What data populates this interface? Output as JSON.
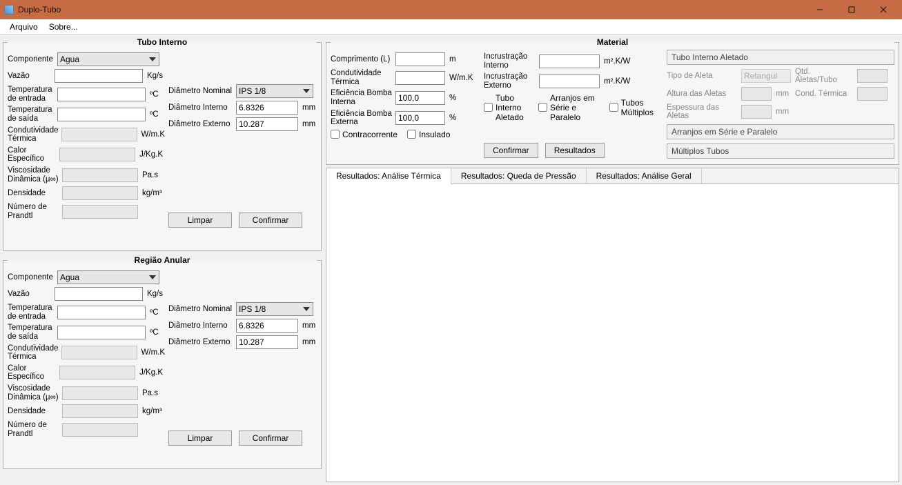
{
  "window": {
    "title": "Duplo-Tubo"
  },
  "menu": {
    "arquivo": "Arquivo",
    "sobre": "Sobre..."
  },
  "tubo_interno": {
    "legend": "Tubo Interno",
    "componente_label": "Componente",
    "componente_value": "Agua",
    "vazao_label": "Vazão",
    "vazao_unit": "Kg/s",
    "temp_entrada_label": "Temperatura de entrada",
    "temp_entrada_unit": "ºC",
    "temp_saida_label": "Temperatura de saída",
    "temp_saida_unit": "ºC",
    "diam_nom_label": "Diâmetro Nominal",
    "diam_nom_value": "IPS 1/8",
    "diam_int_label": "Diâmetro Interno",
    "diam_int_value": "6.8326",
    "diam_int_unit": "mm",
    "diam_ext_label": "Diâmetro Externo",
    "diam_ext_value": "10.287",
    "diam_ext_unit": "mm",
    "cond_term_label": "Condutividade Térmica",
    "cond_term_unit": "W/m.K",
    "calor_esp_label": "Calor Específico",
    "calor_esp_unit": "J/Kg.K",
    "visc_din_label": "Viscosidade Dinâmica (µ∞)",
    "visc_din_unit": "Pa.s",
    "dens_label": "Densidade",
    "dens_unit": "kg/m³",
    "prandtl_label": "Número de Prandtl",
    "btn_limpar": "Limpar",
    "btn_confirmar": "Confirmar"
  },
  "regiao_anular": {
    "legend": "Região Anular",
    "componente_label": "Componente",
    "componente_value": "Agua",
    "vazao_label": "Vazão",
    "vazao_unit": "Kg/s",
    "temp_entrada_label": "Temperatura de entrada",
    "temp_entrada_unit": "ºC",
    "temp_saida_label": "Temperatura de saída",
    "temp_saida_unit": "ºC",
    "diam_nom_label": "Diâmetro Nominal",
    "diam_nom_value": "IPS 1/8",
    "diam_int_label": "Diâmetro Interno",
    "diam_int_value": "6.8326",
    "diam_int_unit": "mm",
    "diam_ext_label": "Diâmetro Externo",
    "diam_ext_value": "10.287",
    "diam_ext_unit": "mm",
    "cond_term_label": "Condutividade Térmica",
    "cond_term_unit": "W/m.K",
    "calor_esp_label": "Calor Específico",
    "calor_esp_unit": "J/Kg.K",
    "visc_din_label": "Viscosidade Dinâmica (µ∞)",
    "visc_din_unit": "Pa.s",
    "dens_label": "Densidade",
    "dens_unit": "kg/m³",
    "prandtl_label": "Número de Prandtl",
    "btn_limpar": "Limpar",
    "btn_confirmar": "Confirmar"
  },
  "material": {
    "legend": "Material",
    "comprimento_label": "Comprimento (L)",
    "comprimento_unit": "m",
    "cond_term_label": "Condutividade Térmica",
    "cond_term_unit": "W/m.K",
    "ef_bomba_int_label": "Eficiência Bomba Interna",
    "ef_bomba_int_value": "100,0",
    "ef_bomba_int_unit": "%",
    "ef_bomba_ext_label": "Eficiência Bomba Externa",
    "ef_bomba_ext_value": "100,0",
    "ef_bomba_ext_unit": "%",
    "incr_int_label": "Incrustração Interno",
    "incr_int_unit": "m².K/W",
    "incr_ext_label": "Incrustração Externo",
    "incr_ext_unit": "m².K/W",
    "chk_tubo_aletado": "Tubo Interno Aletado",
    "chk_arranjos": "Arranjos em Série e Paralelo",
    "chk_tubos_mult": "Tubos Múltiplos",
    "chk_contracorrente": "Contracorrente",
    "chk_insulado": "Insulado",
    "btn_confirmar": "Confirmar",
    "btn_resultados": "Resultados",
    "box_tubo_aletado": "Tubo Interno Aletado",
    "fin_tipo_label": "Tipo de Aleta",
    "fin_tipo_value": "Retangular",
    "fin_qtd_label": "Qtd. Aletas/Tubo",
    "fin_altura_label": "Altura das Aletas",
    "fin_altura_unit": "mm",
    "fin_cond_label": "Cond. Térmica",
    "fin_esp_label": "Espessura das Aletas",
    "fin_esp_unit": "mm",
    "box_arranjos": "Arranjos em Série e Paralelo",
    "box_mult": "Múltiplos Tubos"
  },
  "tabs": {
    "t1": "Resultados: Análise Térmica",
    "t2": "Resultados: Queda de Pressão",
    "t3": "Resultados: Análise Geral"
  }
}
